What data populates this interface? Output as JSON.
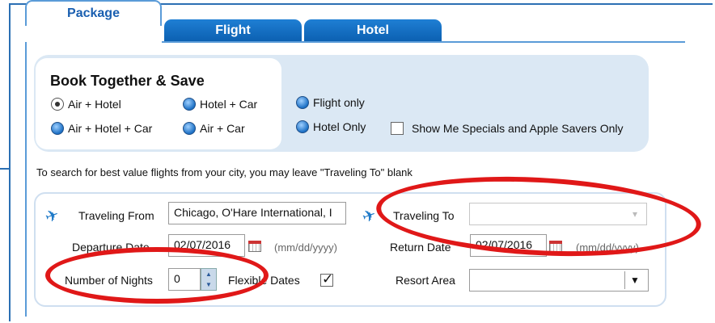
{
  "tabs": [
    {
      "label": "Package",
      "active": true
    },
    {
      "label": "Flight",
      "active": false
    },
    {
      "label": "Hotel",
      "active": false
    }
  ],
  "booking": {
    "heading": "Book Together & Save",
    "options": [
      {
        "label": "Air + Hotel",
        "checked": true
      },
      {
        "label": "Hotel + Car",
        "checked": false
      },
      {
        "label": "Air + Hotel + Car",
        "checked": false
      },
      {
        "label": "Air + Car",
        "checked": false
      },
      {
        "label": "Flight only",
        "checked": false
      },
      {
        "label": "Hotel Only",
        "checked": false
      }
    ],
    "specials_label": "Show Me Specials and Apple Savers Only",
    "specials_checked": false
  },
  "helper_text": "To search for best value flights from your city, you may leave \"Traveling To\" blank",
  "form": {
    "traveling_from_label": "Traveling From",
    "traveling_from_value": "Chicago, O'Hare International, I",
    "traveling_to_label": "Traveling To",
    "traveling_to_value": "",
    "departure_label": "Departure Date",
    "departure_value": "02/07/2016",
    "departure_hint": "(mm/dd/yyyy)",
    "return_label": "Return Date",
    "return_value": "02/07/2016",
    "return_hint": "(mm/dd/yyyy)",
    "nights_label": "Number of Nights",
    "nights_value": "0",
    "flexible_label": "Flexible Dates",
    "flexible_checked": true,
    "resort_label": "Resort Area",
    "resort_value": ""
  },
  "colors": {
    "tab_blue": "#0b5fb0",
    "panel_blue": "#dbe8f4",
    "highlight_red": "#e01818"
  }
}
